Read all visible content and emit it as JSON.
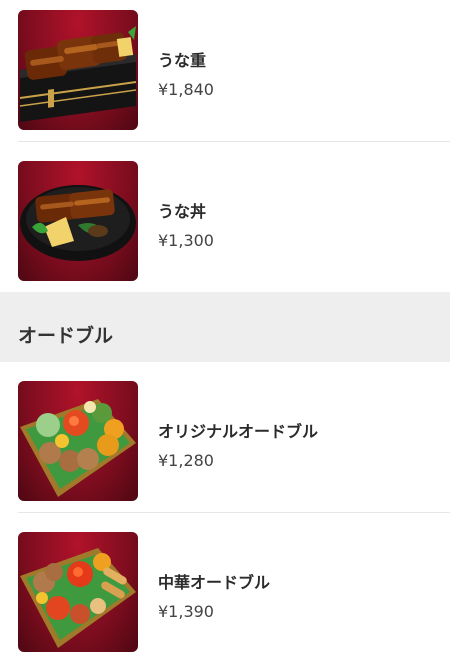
{
  "menu": {
    "top_items": [
      {
        "name": "うな重",
        "price": "¥1,840",
        "image": "unaju-photo"
      },
      {
        "name": "うな丼",
        "price": "¥1,300",
        "image": "unadon-photo"
      }
    ],
    "section": {
      "title": "オードブル",
      "items": [
        {
          "name": "オリジナルオードブル",
          "price": "¥1,280",
          "image": "original-hors-doeuvre-photo"
        },
        {
          "name": "中華オードブル",
          "price": "¥1,390",
          "image": "chinese-hors-doeuvre-photo"
        }
      ]
    }
  },
  "colors": {
    "photo_background": "#8e0f22",
    "section_header_bg": "#eeeeee",
    "divider": "#e6e6e6"
  }
}
